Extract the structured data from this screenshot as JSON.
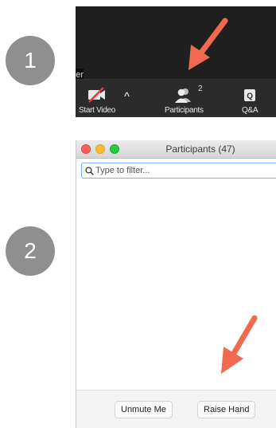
{
  "steps": [
    "1",
    "2"
  ],
  "toolbar": {
    "edge_label": "er",
    "start_video_label": "Start Video",
    "participants_label": "Participants",
    "participants_count": "2",
    "qa_label": "Q&A",
    "qa_icon_letter": "Q"
  },
  "participants_window": {
    "title": "Participants (47)",
    "filter_placeholder": "Type to filter...",
    "unmute_label": "Unmute Me",
    "raise_hand_label": "Raise Hand"
  },
  "colors": {
    "arrow": "#f06a4f",
    "step_circle": "#8f8f8f",
    "filter_border": "#7eaef0"
  },
  "icons": [
    "video-off-icon",
    "participants-icon",
    "qa-icon",
    "chevron-up-icon",
    "search-icon",
    "pointer-arrow"
  ]
}
